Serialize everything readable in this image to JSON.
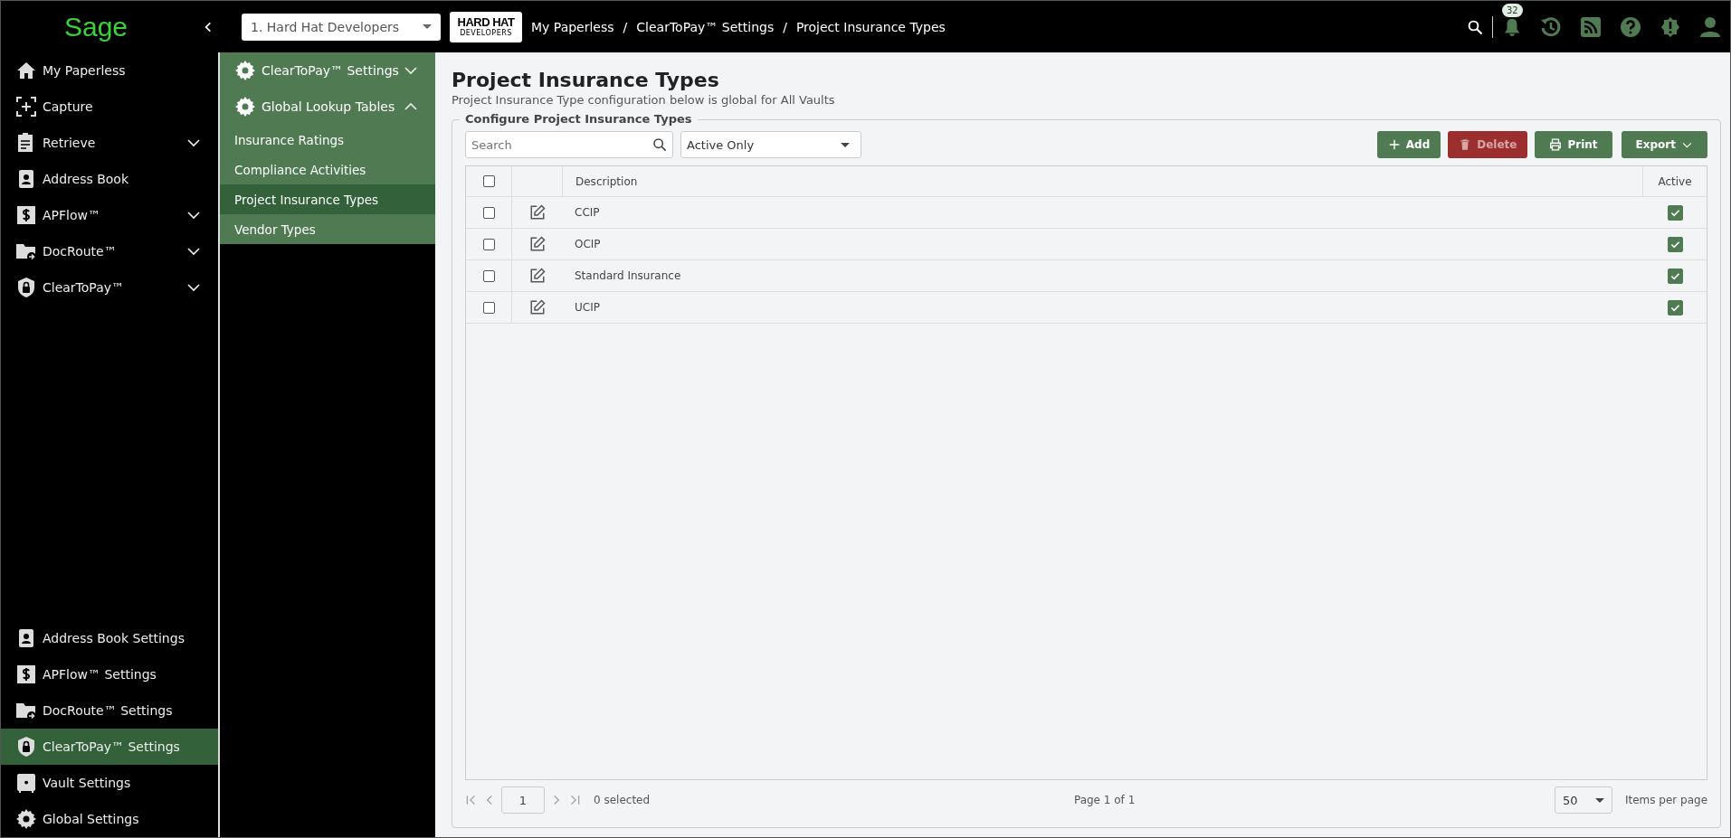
{
  "header": {
    "logo": "Sage",
    "vault_select": "1. Hard Hat Developers",
    "company_logo": {
      "line_1": "HARD HAT",
      "line_2": "DEVELOPERS"
    },
    "breadcrumbs": [
      "My Paperless",
      "ClearToPay™ Settings",
      "Project Insurance Types"
    ],
    "breadcrumb_separators": [
      "/",
      "/"
    ],
    "notification_count": "32"
  },
  "sidebar": {
    "items": [
      {
        "label": "My Paperless",
        "selected": false
      },
      {
        "label": "Capture",
        "selected": false
      },
      {
        "label": "Retrieve",
        "selected": false,
        "expanded": false
      },
      {
        "label": "Address Book",
        "selected": false
      },
      {
        "label": "APFlow™",
        "selected": false,
        "expanded": false
      },
      {
        "label": "DocRoute™",
        "selected": false,
        "expanded": false
      },
      {
        "label": "ClearToPay™",
        "selected": false,
        "expanded": false
      }
    ],
    "settings_items": [
      {
        "label": "Address Book Settings",
        "selected": false
      },
      {
        "label": "APFlow™ Settings",
        "selected": false
      },
      {
        "label": "DocRoute™ Settings",
        "selected": false
      },
      {
        "label": "ClearToPay™ Settings",
        "selected": true
      },
      {
        "label": "Vault Settings",
        "selected": false
      },
      {
        "label": "Global Settings",
        "selected": false
      }
    ]
  },
  "subnav": {
    "sections": [
      {
        "label": "ClearToPay™ Settings",
        "expanded": false
      },
      {
        "label": "Global Lookup Tables",
        "expanded": true,
        "children": [
          {
            "label": "Insurance Ratings",
            "selected": false
          },
          {
            "label": "Compliance Activities",
            "selected": false
          },
          {
            "label": "Project Insurance Types",
            "selected": true
          },
          {
            "label": "Vendor Types",
            "selected": false
          }
        ]
      }
    ]
  },
  "page": {
    "title": "Project Insurance Types",
    "subtitle": "Project Insurance Type configuration below is global for All Vaults",
    "panel_title": "Configure Project Insurance Types",
    "search": {
      "placeholder": "Search"
    },
    "filter": "Active Only",
    "buttons": [
      {
        "label": "Add",
        "kind": "add",
        "disabled": false
      },
      {
        "label": "Delete",
        "kind": "delete",
        "disabled": true
      },
      {
        "label": "Print",
        "kind": "print",
        "disabled": false
      },
      {
        "label": "Export",
        "kind": "export",
        "disabled": false
      }
    ],
    "table": {
      "select_all": false,
      "columns": [
        "Description",
        "Active"
      ],
      "rows": [
        {
          "checked": false,
          "description": "CCIP",
          "active": true
        },
        {
          "checked": false,
          "description": "OCIP",
          "active": true
        },
        {
          "checked": false,
          "description": "Standard Insurance",
          "active": true
        },
        {
          "checked": false,
          "description": "UCIP",
          "active": true
        }
      ]
    },
    "pager": {
      "page": "1",
      "selected_count": "0 selected",
      "page_info": "Page 1 of 1",
      "page_size": "50",
      "page_size_label": "Items per page"
    }
  }
}
